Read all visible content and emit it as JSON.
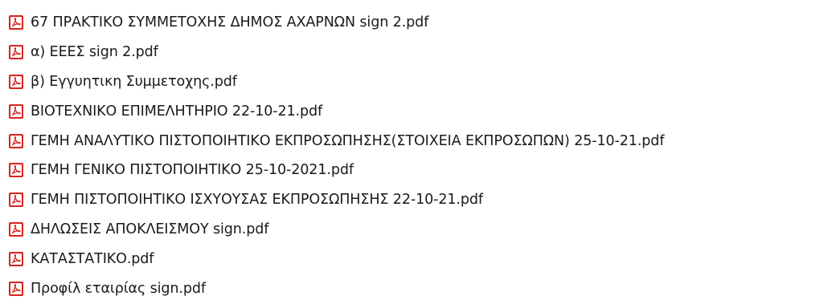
{
  "file_icon": "pdf-file-icon",
  "icon_colors": {
    "frame": "#d8241f",
    "fill": "#ffffff",
    "glyph": "#d8241f"
  },
  "files": [
    {
      "name": "67 ΠΡΑΚΤΙΚΟ ΣΥΜΜΕΤΟΧΗΣ ΔΗΜΟΣ ΑΧΑΡΝΩΝ sign 2.pdf"
    },
    {
      "name": "α) ΕΕΕΣ sign 2.pdf"
    },
    {
      "name": "β) Εγγυητικη Συμμετοχης.pdf"
    },
    {
      "name": "ΒΙΟΤΕΧΝΙΚΟ ΕΠΙΜΕΛΗΤΗΡΙΟ 22-10-21.pdf"
    },
    {
      "name": "ΓΕΜΗ ΑΝΑΛΥΤΙΚΟ ΠΙΣΤΟΠΟΙΗΤΙΚΟ ΕΚΠΡΟΣΩΠΗΣΗΣ(ΣΤΟΙΧΕΙΑ ΕΚΠΡΟΣΩΠΩΝ) 25-10-21.pdf"
    },
    {
      "name": "ΓΕΜΗ ΓΕΝΙΚΟ ΠΙΣΤΟΠΟΙΗΤΙΚΟ 25-10-2021.pdf"
    },
    {
      "name": "ΓΕΜΗ ΠΙΣΤΟΠΟΙΗΤΙΚΟ ΙΣΧΥΟΥΣΑΣ ΕΚΠΡΟΣΩΠΗΣΗΣ 22-10-21.pdf"
    },
    {
      "name": "ΔΗΛΩΣΕΙΣ ΑΠΟΚΛΕΙΣΜΟΥ sign.pdf"
    },
    {
      "name": "ΚΑΤΑΣΤΑΤΙΚΟ.pdf"
    },
    {
      "name": "Προφίλ εταιρίας sign.pdf"
    }
  ]
}
